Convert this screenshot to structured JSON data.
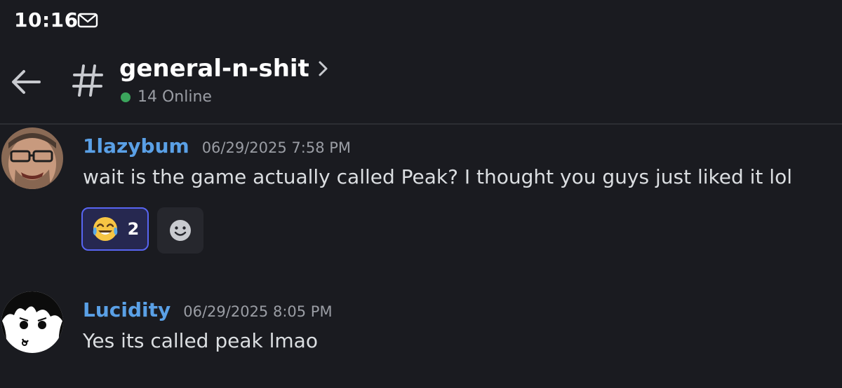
{
  "status_bar": {
    "time": "10:16",
    "notification_icon": "gmail-icon"
  },
  "header": {
    "back_icon": "arrow-left-icon",
    "channel_icon": "hash-icon",
    "channel_name": "general-n-shit",
    "chevron_icon": "chevron-right-icon",
    "online_text": "14 Online",
    "online_color": "#3ba55c"
  },
  "messages": [
    {
      "username": "1lazybum",
      "timestamp": "06/29/2025 7:58 PM",
      "text": "wait is the game actually called Peak? I thought you guys just liked it lol",
      "reactions": [
        {
          "emoji": "😂",
          "icon": "joy-emoji-icon",
          "count": "2"
        }
      ],
      "add_reaction_icon": "smiley-icon"
    },
    {
      "username": "Lucidity",
      "timestamp": "06/29/2025 8:05 PM",
      "text": "Yes its called peak lmao"
    }
  ],
  "colors": {
    "background": "#1a1b20",
    "username": "#5aa0e6",
    "reaction_border": "#5865f2",
    "muted_text": "#9a9da4"
  }
}
